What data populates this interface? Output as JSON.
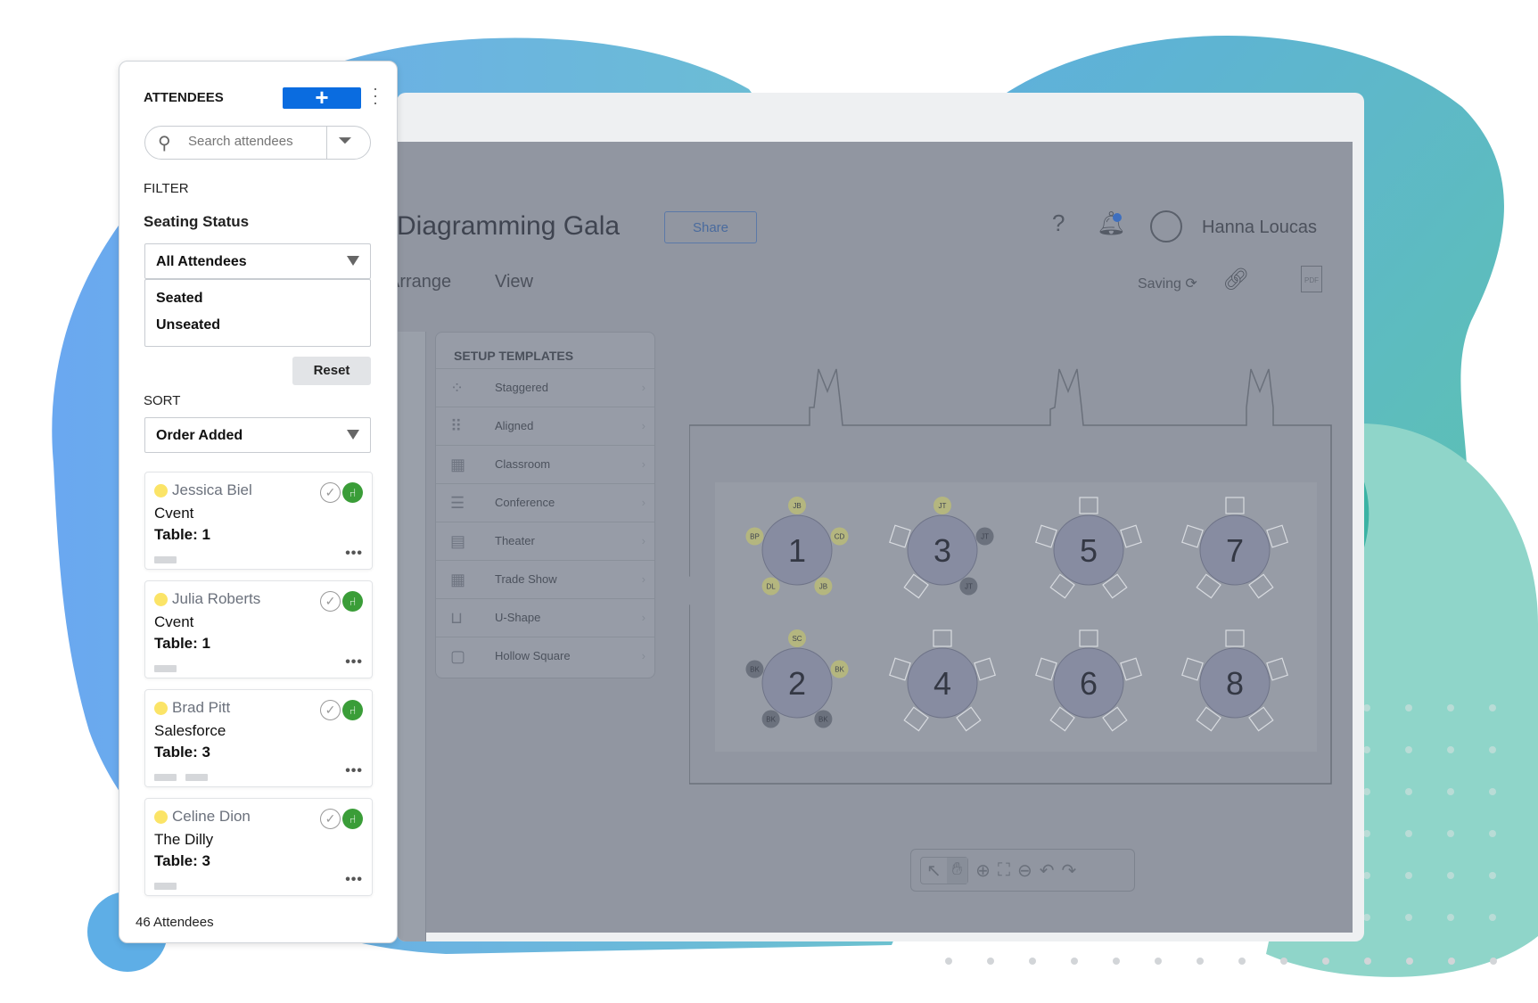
{
  "colors": {
    "accent": "#0a6ce0",
    "seated": "#3a9d38",
    "status_dot": "#fbe467",
    "overlay": "#9196a1"
  },
  "attendees_panel": {
    "title": "ATTENDEES",
    "add_icon": "plus-icon",
    "more_icon": "kebab-icon",
    "search_placeholder": "Search attendees",
    "filter_label": "FILTER",
    "seating_status_label": "Seating Status",
    "seating_status_value": "All Attendees",
    "seating_options": [
      "Seated",
      "Unseated"
    ],
    "reset_label": "Reset",
    "sort_label": "SORT",
    "sort_value": "Order Added",
    "attendees": [
      {
        "name": "Jessica Biel",
        "company": "Cvent",
        "table": "Table: 1",
        "tags": 1
      },
      {
        "name": "Julia Roberts",
        "company": "Cvent",
        "table": "Table: 1",
        "tags": 1
      },
      {
        "name": "Brad Pitt",
        "company": "Salesforce",
        "table": "Table: 3",
        "tags": 2
      },
      {
        "name": "Celine Dion",
        "company": "The Dilly",
        "table": "Table: 3",
        "tags": 1
      }
    ],
    "count": "46 Attendees"
  },
  "app": {
    "title": "Diagramming Gala",
    "share_label": "Share",
    "user_name": "Hanna Loucas",
    "tabs": [
      "Arrange",
      "View"
    ],
    "saving_label": "Saving",
    "templates_title": "SETUP TEMPLATES",
    "templates": [
      "Staggered",
      "Aligned",
      "Classroom",
      "Conference",
      "Theater",
      "Trade Show",
      "U-Shape",
      "Hollow Square"
    ],
    "tables": [
      {
        "number": "1",
        "seats": [
          [
            "JB",
            "y"
          ],
          [
            "CD",
            "y"
          ],
          [
            "JB",
            "y"
          ],
          [
            "DL",
            "y"
          ],
          [
            "BP",
            "y"
          ]
        ]
      },
      {
        "number": "3",
        "seats": [
          [
            "JT",
            "y"
          ],
          [
            "JT",
            "d"
          ],
          [
            "JT",
            "d"
          ],
          [
            "",
            ""
          ],
          [
            "",
            ""
          ]
        ]
      },
      {
        "number": "5",
        "seats": [
          [
            "",
            ""
          ],
          [
            "",
            ""
          ],
          [
            "",
            ""
          ],
          [
            "",
            ""
          ],
          [
            "",
            ""
          ]
        ]
      },
      {
        "number": "7",
        "seats": [
          [
            "",
            ""
          ],
          [
            "",
            ""
          ],
          [
            "",
            ""
          ],
          [
            "",
            ""
          ],
          [
            "",
            ""
          ]
        ]
      },
      {
        "number": "2",
        "seats": [
          [
            "SC",
            "y"
          ],
          [
            "BK",
            "y"
          ],
          [
            "BK",
            "d"
          ],
          [
            "BK",
            "d"
          ],
          [
            "BK",
            "d"
          ]
        ]
      },
      {
        "number": "4",
        "seats": [
          [
            "",
            ""
          ],
          [
            "",
            ""
          ],
          [
            "",
            ""
          ],
          [
            "",
            ""
          ],
          [
            "",
            ""
          ]
        ]
      },
      {
        "number": "6",
        "seats": [
          [
            "",
            ""
          ],
          [
            "",
            ""
          ],
          [
            "",
            ""
          ],
          [
            "",
            ""
          ],
          [
            "",
            ""
          ]
        ]
      },
      {
        "number": "8",
        "seats": [
          [
            "",
            ""
          ],
          [
            "",
            ""
          ],
          [
            "",
            ""
          ],
          [
            "",
            ""
          ],
          [
            "",
            ""
          ]
        ]
      }
    ]
  }
}
